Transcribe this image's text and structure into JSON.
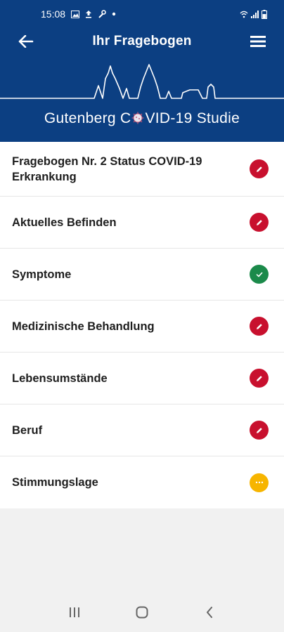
{
  "status_bar": {
    "time": "15:08",
    "icons": [
      "image-icon",
      "upload-icon",
      "wrench-icon",
      "dot-icon"
    ],
    "right_icons": [
      "wifi-icon",
      "signal-icon",
      "battery-icon"
    ]
  },
  "header": {
    "title": "Ihr Fragebogen",
    "study_title_part1": "Gutenberg C",
    "study_title_part2": "VID-19 Studie",
    "back_icon": "arrow-left-icon",
    "menu_icon": "hamburger-menu-icon",
    "background_color": "#0c3f82"
  },
  "questionnaire": {
    "items": [
      {
        "label": "Fragebogen Nr. 2 Status COVID-19 Erkrankung",
        "status": "edit",
        "status_icon": "pencil-icon"
      },
      {
        "label": "Aktuelles Befinden",
        "status": "edit",
        "status_icon": "pencil-icon"
      },
      {
        "label": "Symptome",
        "status": "done",
        "status_icon": "checkmark-icon"
      },
      {
        "label": "Medizinische Behandlung",
        "status": "edit",
        "status_icon": "pencil-icon"
      },
      {
        "label": "Lebensumstände",
        "status": "edit",
        "status_icon": "pencil-icon"
      },
      {
        "label": "Beruf",
        "status": "edit",
        "status_icon": "pencil-icon"
      },
      {
        "label": "Stimmungslage",
        "status": "pending",
        "status_icon": "ellipsis-icon"
      }
    ]
  },
  "colors": {
    "edit": "#c8102e",
    "done": "#1b8a4a",
    "pending": "#f7b500"
  },
  "nav_bar": {
    "buttons": [
      "recents-icon",
      "home-icon",
      "back-nav-icon"
    ]
  }
}
